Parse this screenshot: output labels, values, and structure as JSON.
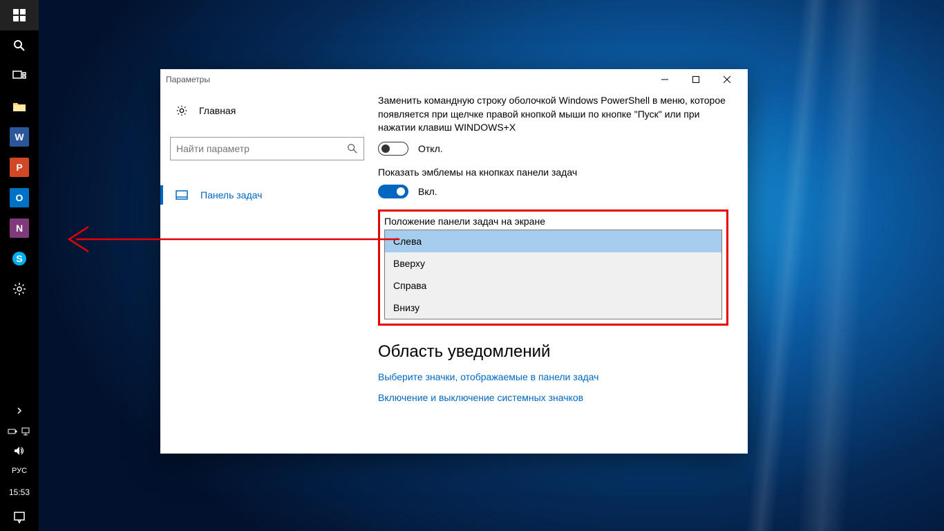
{
  "taskbar": {
    "lang": "РУС",
    "clock": "15:53"
  },
  "window": {
    "title": "Параметры"
  },
  "sidebar": {
    "home": "Главная",
    "search_placeholder": "Найти параметр",
    "nav_item": "Панель задач"
  },
  "content": {
    "powershell_desc": "Заменить командную строку оболочкой Windows PowerShell в меню, которое появляется при щелчке правой кнопкой мыши по кнопке \"Пуск\" или при нажатии клавиш WINDOWS+X",
    "off_label": "Откл.",
    "badges_label": "Показать эмблемы на кнопках панели задач",
    "on_label": "Вкл.",
    "position_label": "Положение панели задач на экране",
    "options": [
      "Слева",
      "Вверху",
      "Справа",
      "Внизу"
    ],
    "notif_heading": "Область уведомлений",
    "link1": "Выберите значки, отображаемые в панели задач",
    "link2": "Включение и выключение системных значков"
  }
}
